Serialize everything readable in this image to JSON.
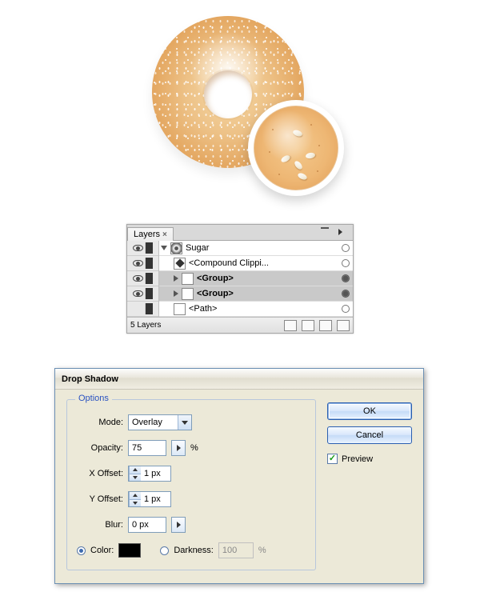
{
  "layers_panel": {
    "tab_label": "Layers",
    "footer_text": "5 Layers",
    "rows": [
      {
        "label": "Sugar",
        "bold": false
      },
      {
        "label": "<Compound Clippi...",
        "bold": false
      },
      {
        "label": "<Group>",
        "bold": true
      },
      {
        "label": "<Group>",
        "bold": true
      },
      {
        "label": "<Path>",
        "bold": false
      }
    ]
  },
  "dialog": {
    "title": "Drop Shadow",
    "legend": "Options",
    "labels": {
      "mode": "Mode:",
      "opacity": "Opacity:",
      "x_offset": "X Offset:",
      "y_offset": "Y Offset:",
      "blur": "Blur:",
      "color": "Color:",
      "darkness": "Darkness:"
    },
    "values": {
      "mode": "Overlay",
      "opacity": "75",
      "opacity_suffix": "%",
      "x_offset": "1 px",
      "y_offset": "1 px",
      "blur": "0 px",
      "darkness": "100",
      "darkness_suffix": "%",
      "color_hex": "#000000"
    },
    "buttons": {
      "ok": "OK",
      "cancel": "Cancel",
      "preview": "Preview"
    }
  }
}
